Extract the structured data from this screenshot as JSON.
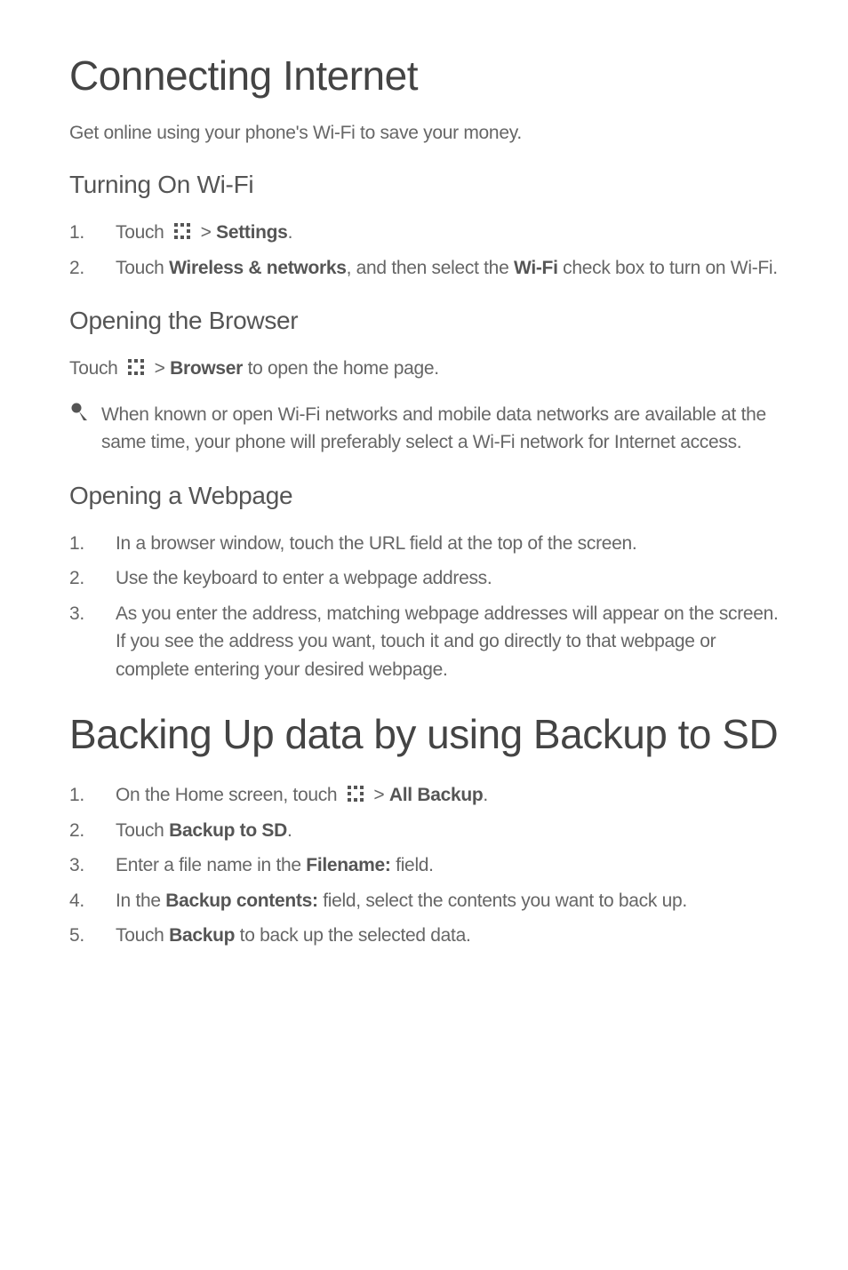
{
  "s1": {
    "title": "Connecting Internet",
    "intro": "Get online using your phone's Wi-Fi to save your money.",
    "h2_wifi": "Turning On Wi-Fi",
    "wifi_steps": {
      "n1": "1.",
      "t1a": "Touch ",
      "t1b": " > ",
      "t1c": "Settings",
      "t1d": ".",
      "n2": "2.",
      "t2a": "Touch ",
      "t2b": "Wireless & networks",
      "t2c": ", and then select the ",
      "t2d": "Wi-Fi",
      "t2e": " check box to turn on Wi-Fi."
    },
    "h2_browser": "Opening the Browser",
    "browser_para_a": "Touch ",
    "browser_para_b": " > ",
    "browser_para_c": "Browser",
    "browser_para_d": "  to open the home page.",
    "note": "When known or open Wi-Fi networks and mobile data networks are available at the same time, your phone will preferably select a Wi-Fi network for Internet access.",
    "h2_webpage": "Opening a Webpage",
    "web_steps": {
      "n1": "1.",
      "t1": "In a browser window, touch the URL field at the top of the screen.",
      "n2": "2.",
      "t2": "Use the keyboard to enter a webpage address.",
      "n3": "3.",
      "t3": "As you enter the address, matching webpage addresses will appear on the screen. If you see the address you want, touch it and go directly to that webpage or complete entering your desired webpage."
    }
  },
  "s2": {
    "title": "Backing Up data by using Backup to SD",
    "steps": {
      "n1": "1.",
      "t1a": "On the Home screen, touch ",
      "t1b": " > ",
      "t1c": "All Backup",
      "t1d": ".",
      "n2": "2.",
      "t2a": "Touch ",
      "t2b": "Backup to SD",
      "t2c": ".",
      "n3": "3.",
      "t3a": "Enter a file name in the ",
      "t3b": "Filename:",
      "t3c": " field.",
      "n4": "4.",
      "t4a": "In the ",
      "t4b": "Backup contents:",
      "t4c": " field, select the contents you want to back up.",
      "n5": "5.",
      "t5a": "Touch ",
      "t5b": "Backup",
      "t5c": " to back up the selected data."
    }
  }
}
